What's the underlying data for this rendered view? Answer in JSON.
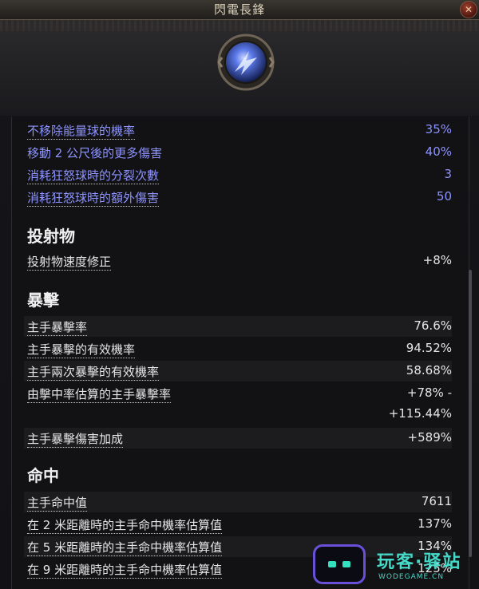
{
  "window": {
    "title": "閃電長鋒",
    "close_glyph": "✕"
  },
  "skill_icon": {
    "name": "lightning-spear-icon",
    "accent": "#5a78e8"
  },
  "blue_stats": [
    {
      "label": "不移除能量球的機率",
      "value": "35%"
    },
    {
      "label": "移動 2 公尺後的更多傷害",
      "value": "40%"
    },
    {
      "label": "消耗狂怒球時的分裂次數",
      "value": "3"
    },
    {
      "label": "消耗狂怒球時的額外傷害",
      "value": "50"
    }
  ],
  "sections": {
    "projectile": {
      "title": "投射物",
      "rows": [
        {
          "label": "投射物速度修正",
          "value": "+8%"
        }
      ]
    },
    "crit": {
      "title": "暴擊",
      "rows": [
        {
          "label": "主手暴擊率",
          "value": "76.6%"
        },
        {
          "label": "主手暴擊的有效機率",
          "value": "94.52%"
        },
        {
          "label": "主手兩次暴擊的有效機率",
          "value": "58.68%"
        },
        {
          "label": "由擊中率估算的主手暴擊率",
          "value": "+78% -",
          "value2": "+115.44%"
        },
        {
          "label": "主手暴擊傷害加成",
          "value": "+589%"
        }
      ]
    },
    "accuracy": {
      "title": "命中",
      "rows": [
        {
          "label": "主手命中值",
          "value": "7611"
        },
        {
          "label": "在 2 米距離時的主手命中機率估算值",
          "value": "137%"
        },
        {
          "label": "在 5 米距離時的主手命中機率估算值",
          "value": "134%"
        },
        {
          "label": "在 9 米距離時的主手命中機率估算值",
          "value": "125%"
        }
      ]
    }
  },
  "watermark": {
    "text": "玩客·驿站",
    "sub": "WODEGAME.CN"
  },
  "colors": {
    "stat_blue": "#8d93ff",
    "stat_white": "#e6e6e6"
  }
}
